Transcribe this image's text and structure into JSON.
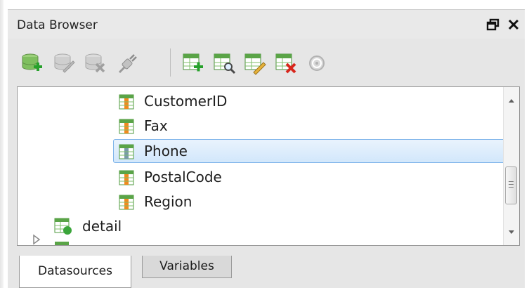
{
  "panel": {
    "title": "Data Browser",
    "restore_icon": "restore-window-icon",
    "close_icon": "close-icon"
  },
  "toolbar": {
    "buttons": [
      {
        "name": "new-datasource-button",
        "icon": "database-add-icon",
        "enabled": true
      },
      {
        "name": "edit-datasource-button",
        "icon": "database-edit-icon",
        "enabled": false
      },
      {
        "name": "delete-datasource-button",
        "icon": "database-delete-icon",
        "enabled": false
      },
      {
        "name": "connect-button",
        "icon": "plug-icon",
        "enabled": false
      },
      {
        "name": "new-table-button",
        "icon": "table-add-icon",
        "enabled": true
      },
      {
        "name": "preview-table-button",
        "icon": "table-preview-icon",
        "enabled": true
      },
      {
        "name": "edit-table-button",
        "icon": "table-edit-icon",
        "enabled": true
      },
      {
        "name": "delete-table-button",
        "icon": "table-delete-icon",
        "enabled": true
      },
      {
        "name": "help-button",
        "icon": "help-icon",
        "enabled": false
      }
    ]
  },
  "tree": {
    "items": [
      {
        "label": "CustomerID",
        "icon": "table-column-icon",
        "selected": false
      },
      {
        "label": "Fax",
        "icon": "table-column-icon",
        "selected": false
      },
      {
        "label": "Phone",
        "icon": "table-column-icon",
        "selected": true
      },
      {
        "label": "PostalCode",
        "icon": "table-column-icon",
        "selected": false
      },
      {
        "label": "Region",
        "icon": "table-column-icon",
        "selected": false
      },
      {
        "label": "detail",
        "icon": "table-datasource-icon",
        "selected": false,
        "expandable": true
      }
    ]
  },
  "tabs": [
    {
      "label": "Datasources",
      "active": true
    },
    {
      "label": "Variables",
      "active": false
    }
  ],
  "colors": {
    "selection_border": "#7eb4ea",
    "selection_fill": "#d2e7fb",
    "panel_bg": "#e6e6e6"
  }
}
